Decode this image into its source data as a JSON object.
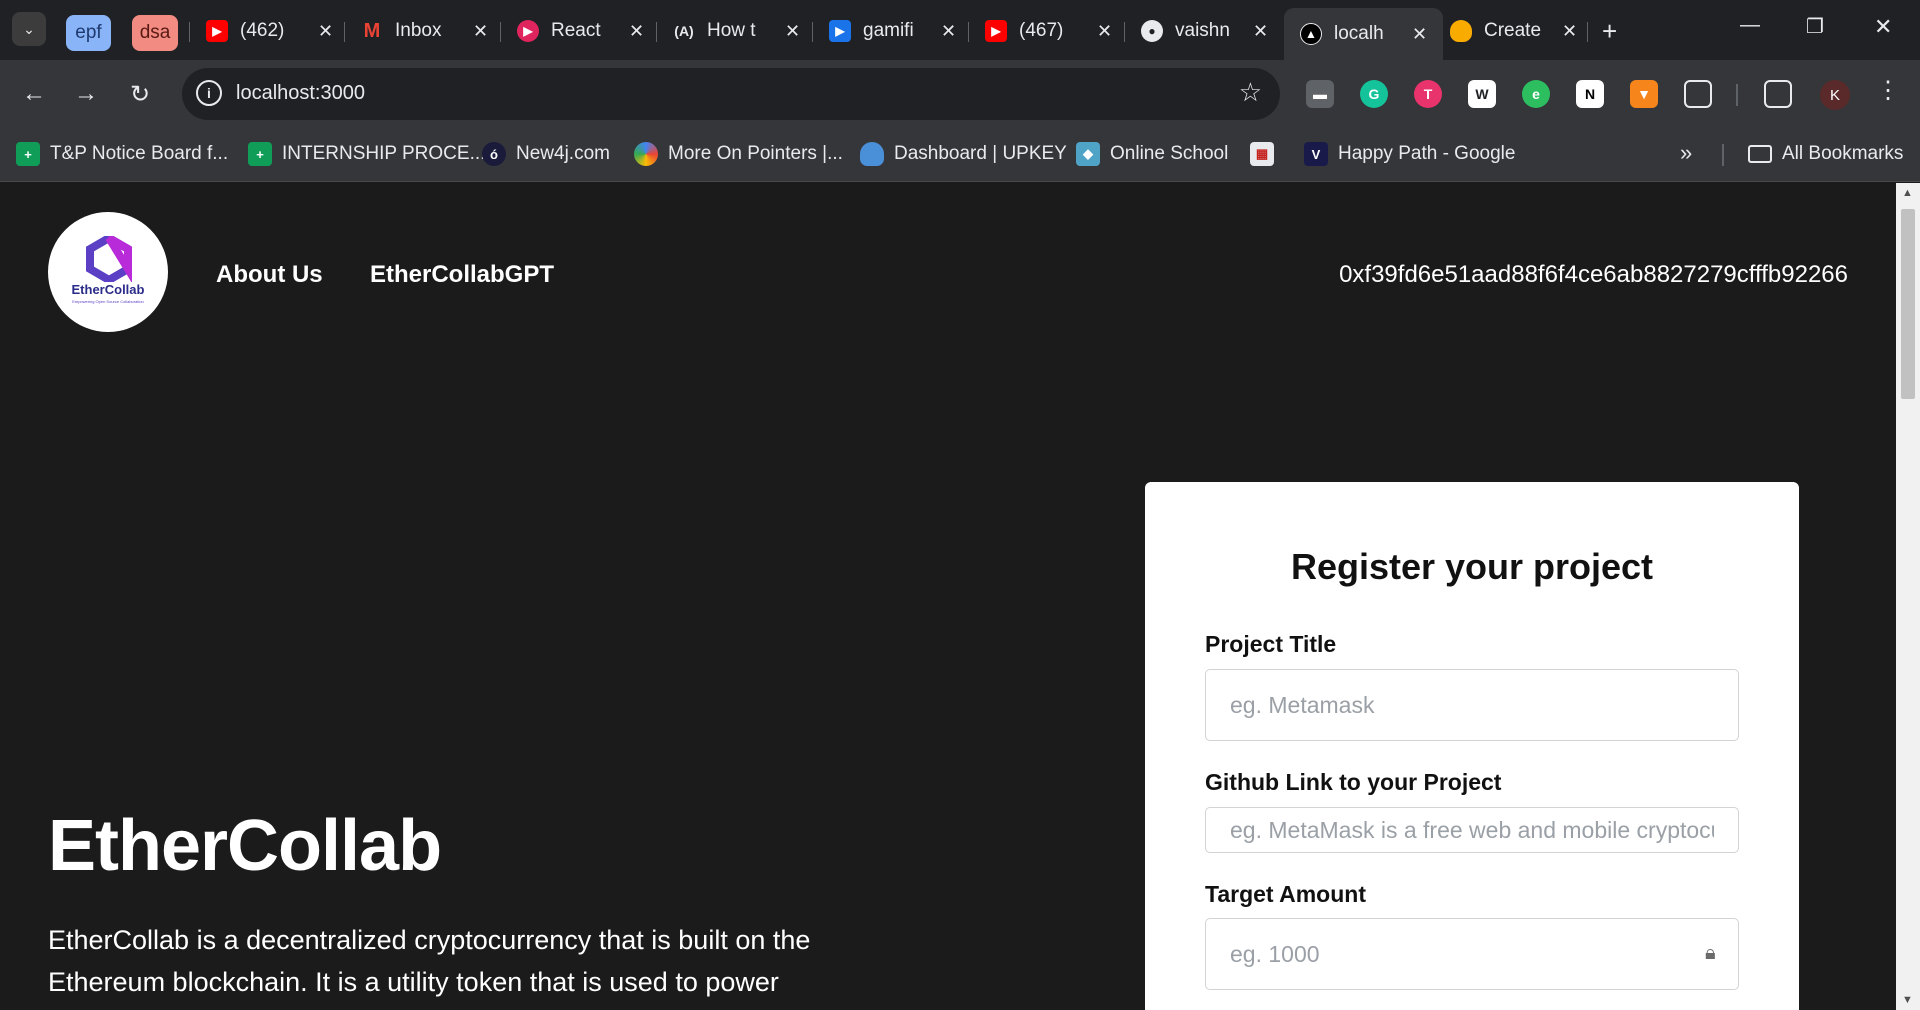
{
  "tabstrip": {
    "group_chips": [
      "epf",
      "dsa"
    ],
    "tabs": [
      {
        "title": "(462)",
        "favicon": "youtube-icon"
      },
      {
        "title": "Inbox",
        "favicon": "gmail-icon"
      },
      {
        "title": "React",
        "favicon": "react-video-icon"
      },
      {
        "title": "How t",
        "favicon": "astro-icon"
      },
      {
        "title": "gamifi",
        "favicon": "video-play-icon"
      },
      {
        "title": "(467)",
        "favicon": "youtube-icon"
      },
      {
        "title": "vaishn",
        "favicon": "github-icon"
      },
      {
        "title": "localh",
        "favicon": "nextjs-icon"
      },
      {
        "title": "Create",
        "favicon": "flame-icon"
      }
    ],
    "active_tab": 7
  },
  "toolbar": {
    "url": "localhost:3000",
    "profile_initial": "K"
  },
  "bookmarks": {
    "items": [
      {
        "label": "T&P Notice Board f...",
        "icon": "sheets-plus-icon"
      },
      {
        "label": "INTERNSHIP PROCE...",
        "icon": "sheets-plus-icon"
      },
      {
        "label": "New4j.com",
        "icon": "new4j-icon"
      },
      {
        "label": "More On Pointers |...",
        "icon": "colorful-ring-icon"
      },
      {
        "label": "Dashboard | UPKEY",
        "icon": "cloud-icon"
      },
      {
        "label": "Online School",
        "icon": "cube-icon"
      },
      {
        "label": "",
        "icon": "store-icon"
      },
      {
        "label": "Happy Path - Google",
        "icon": "v-logo-icon"
      }
    ],
    "all_bookmarks": "All Bookmarks"
  },
  "page": {
    "logo": {
      "name": "EtherCollab",
      "tagline": "Empowering Open Source Collaboration"
    },
    "nav": {
      "about": "About Us",
      "gpt": "EtherCollabGPT"
    },
    "wallet_address": "0xf39fd6e51aad88f6f4ce6ab8827279cfffb92266",
    "hero": {
      "title": "EtherCollab",
      "description": "EtherCollab is a decentralized cryptocurrency that is built on the Ethereum blockchain. It is a utility token that is used to power"
    },
    "form": {
      "title": "Register your project",
      "fields": [
        {
          "label": "Project Title",
          "placeholder": "eg. Metamask"
        },
        {
          "label": "Github Link to your Project",
          "placeholder": "eg. MetaMask is a free web and mobile cryptocurrency wallet"
        },
        {
          "label": "Target Amount",
          "placeholder": "eg. 1000"
        }
      ]
    }
  },
  "colors": {
    "page_bg": "#1b1b1b",
    "chrome_dark": "#202124",
    "chrome_toolbar": "#35363a",
    "card_bg": "#ffffff",
    "logo_purple": "#5b3fc4"
  }
}
